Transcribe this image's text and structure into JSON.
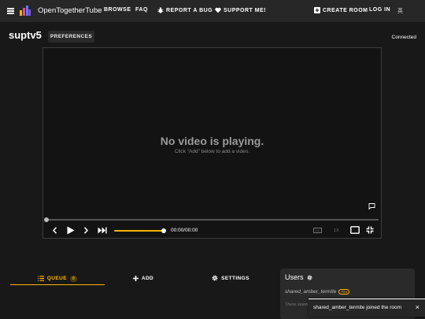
{
  "nav": {
    "brand": "OpenTogetherTube",
    "browse": "BROWSE",
    "faq": "FAQ",
    "report_bug": "REPORT A BUG",
    "support": "SUPPORT ME!",
    "create_room": "CREATE ROOM",
    "log_in": "LOG IN",
    "language": "英"
  },
  "header": {
    "room_title": "suptv5",
    "preferences": "PREFERENCES",
    "status": "Connected"
  },
  "player": {
    "no_video_title": "No video is playing.",
    "no_video_sub": "Click \"Add\" below to add a video.",
    "time": "00:00/00:00",
    "speed": "1X",
    "cc_label": "CC",
    "volume_level": 0.95
  },
  "tabs": {
    "queue": "QUEUE",
    "queue_count": "0",
    "add": "ADD",
    "settings": "SETTINGS"
  },
  "users": {
    "title": "Users",
    "user_name": "shared_amber_termite",
    "you_badge": "You",
    "note": "There seems to be nobody else here."
  },
  "toast": {
    "message": "shared_amber_termite joined the room",
    "close": "×"
  },
  "colors": {
    "accent": "#ffb300",
    "background": "#181818",
    "nav": "#272727"
  }
}
